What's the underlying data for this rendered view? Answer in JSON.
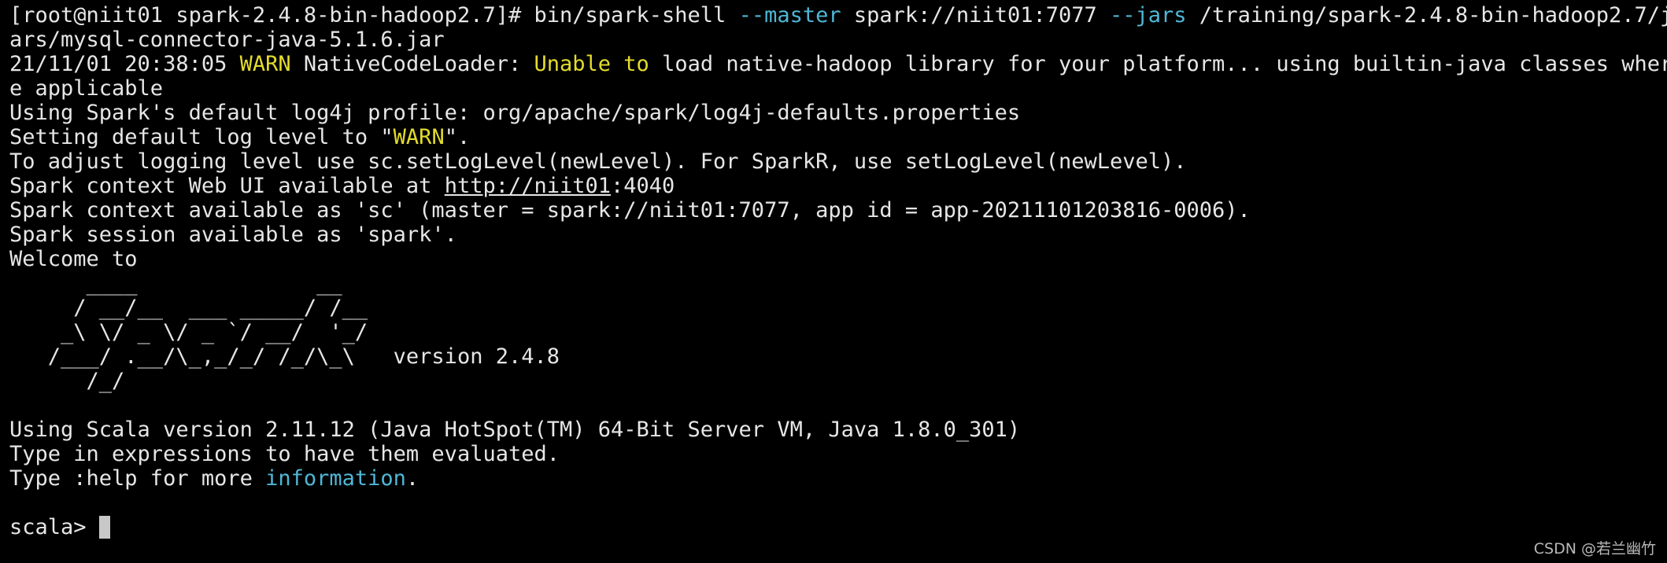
{
  "terminal": {
    "cmd": {
      "prompt": "[root@niit01 spark-2.4.8-bin-hadoop2.7]# ",
      "program": "bin/spark-shell ",
      "opt_master": "--master",
      "master_url": " spark://niit01:7077 ",
      "opt_jars": "--jars",
      "jar_path_1": " /training/spark-2.4.8-bin-hadoop2.7/j",
      "jar_path_2": "ars/mysql-connector-java-5.1.6.jar"
    },
    "warn_line": {
      "timestamp": "21/11/01 20:38:05 ",
      "level": "WARN",
      "source": " NativeCodeLoader: ",
      "unable_to": "Unable to",
      "message": " load native-hadoop library for your platform... using builtin-java classes wher",
      "wrap": "e applicable"
    },
    "log4j_line": "Using Spark's default log4j profile: org/apache/spark/log4j-defaults.properties",
    "log_level_line": {
      "before": "Setting default log level to \"",
      "level": "WARN",
      "after": "\"."
    },
    "adjust_line": "To adjust logging level use sc.setLogLevel(newLevel). For SparkR, use setLogLevel(newLevel).",
    "webui_line": {
      "before": "Spark context Web UI available at ",
      "link": "http://niit01",
      "after": ":4040"
    },
    "context_line": "Spark context available as 'sc' (master = spark://niit01:7077, app id = app-20211101203816-0006).",
    "session_line": "Spark session available as 'spark'.",
    "welcome_line": "Welcome to",
    "banner": [
      "      ____              __",
      "     / __/__  ___ _____/ /__",
      "    _\\ \\/ _ \\/ _ `/ __/  '_/",
      "   /___/ .__/\\_,_/_/ /_/\\_\\   version 2.4.8",
      "      /_/"
    ],
    "scala_line": "Using Scala version 2.11.12 (Java HotSpot(TM) 64-Bit Server VM, Java 1.8.0_301)",
    "type_expr_line": "Type in expressions to have them evaluated.",
    "help_line": {
      "before": "Type :help for more ",
      "info": "information",
      "after": "."
    },
    "scala_prompt": "scala> "
  },
  "watermark": "CSDN @若兰幽竹",
  "colors": {
    "background": "#000000",
    "text": "#e6e6e6",
    "cyan_highlight": "#4fb7d6",
    "yellow_highlight": "#e3dc2c",
    "cursor": "#c8c8c8"
  }
}
